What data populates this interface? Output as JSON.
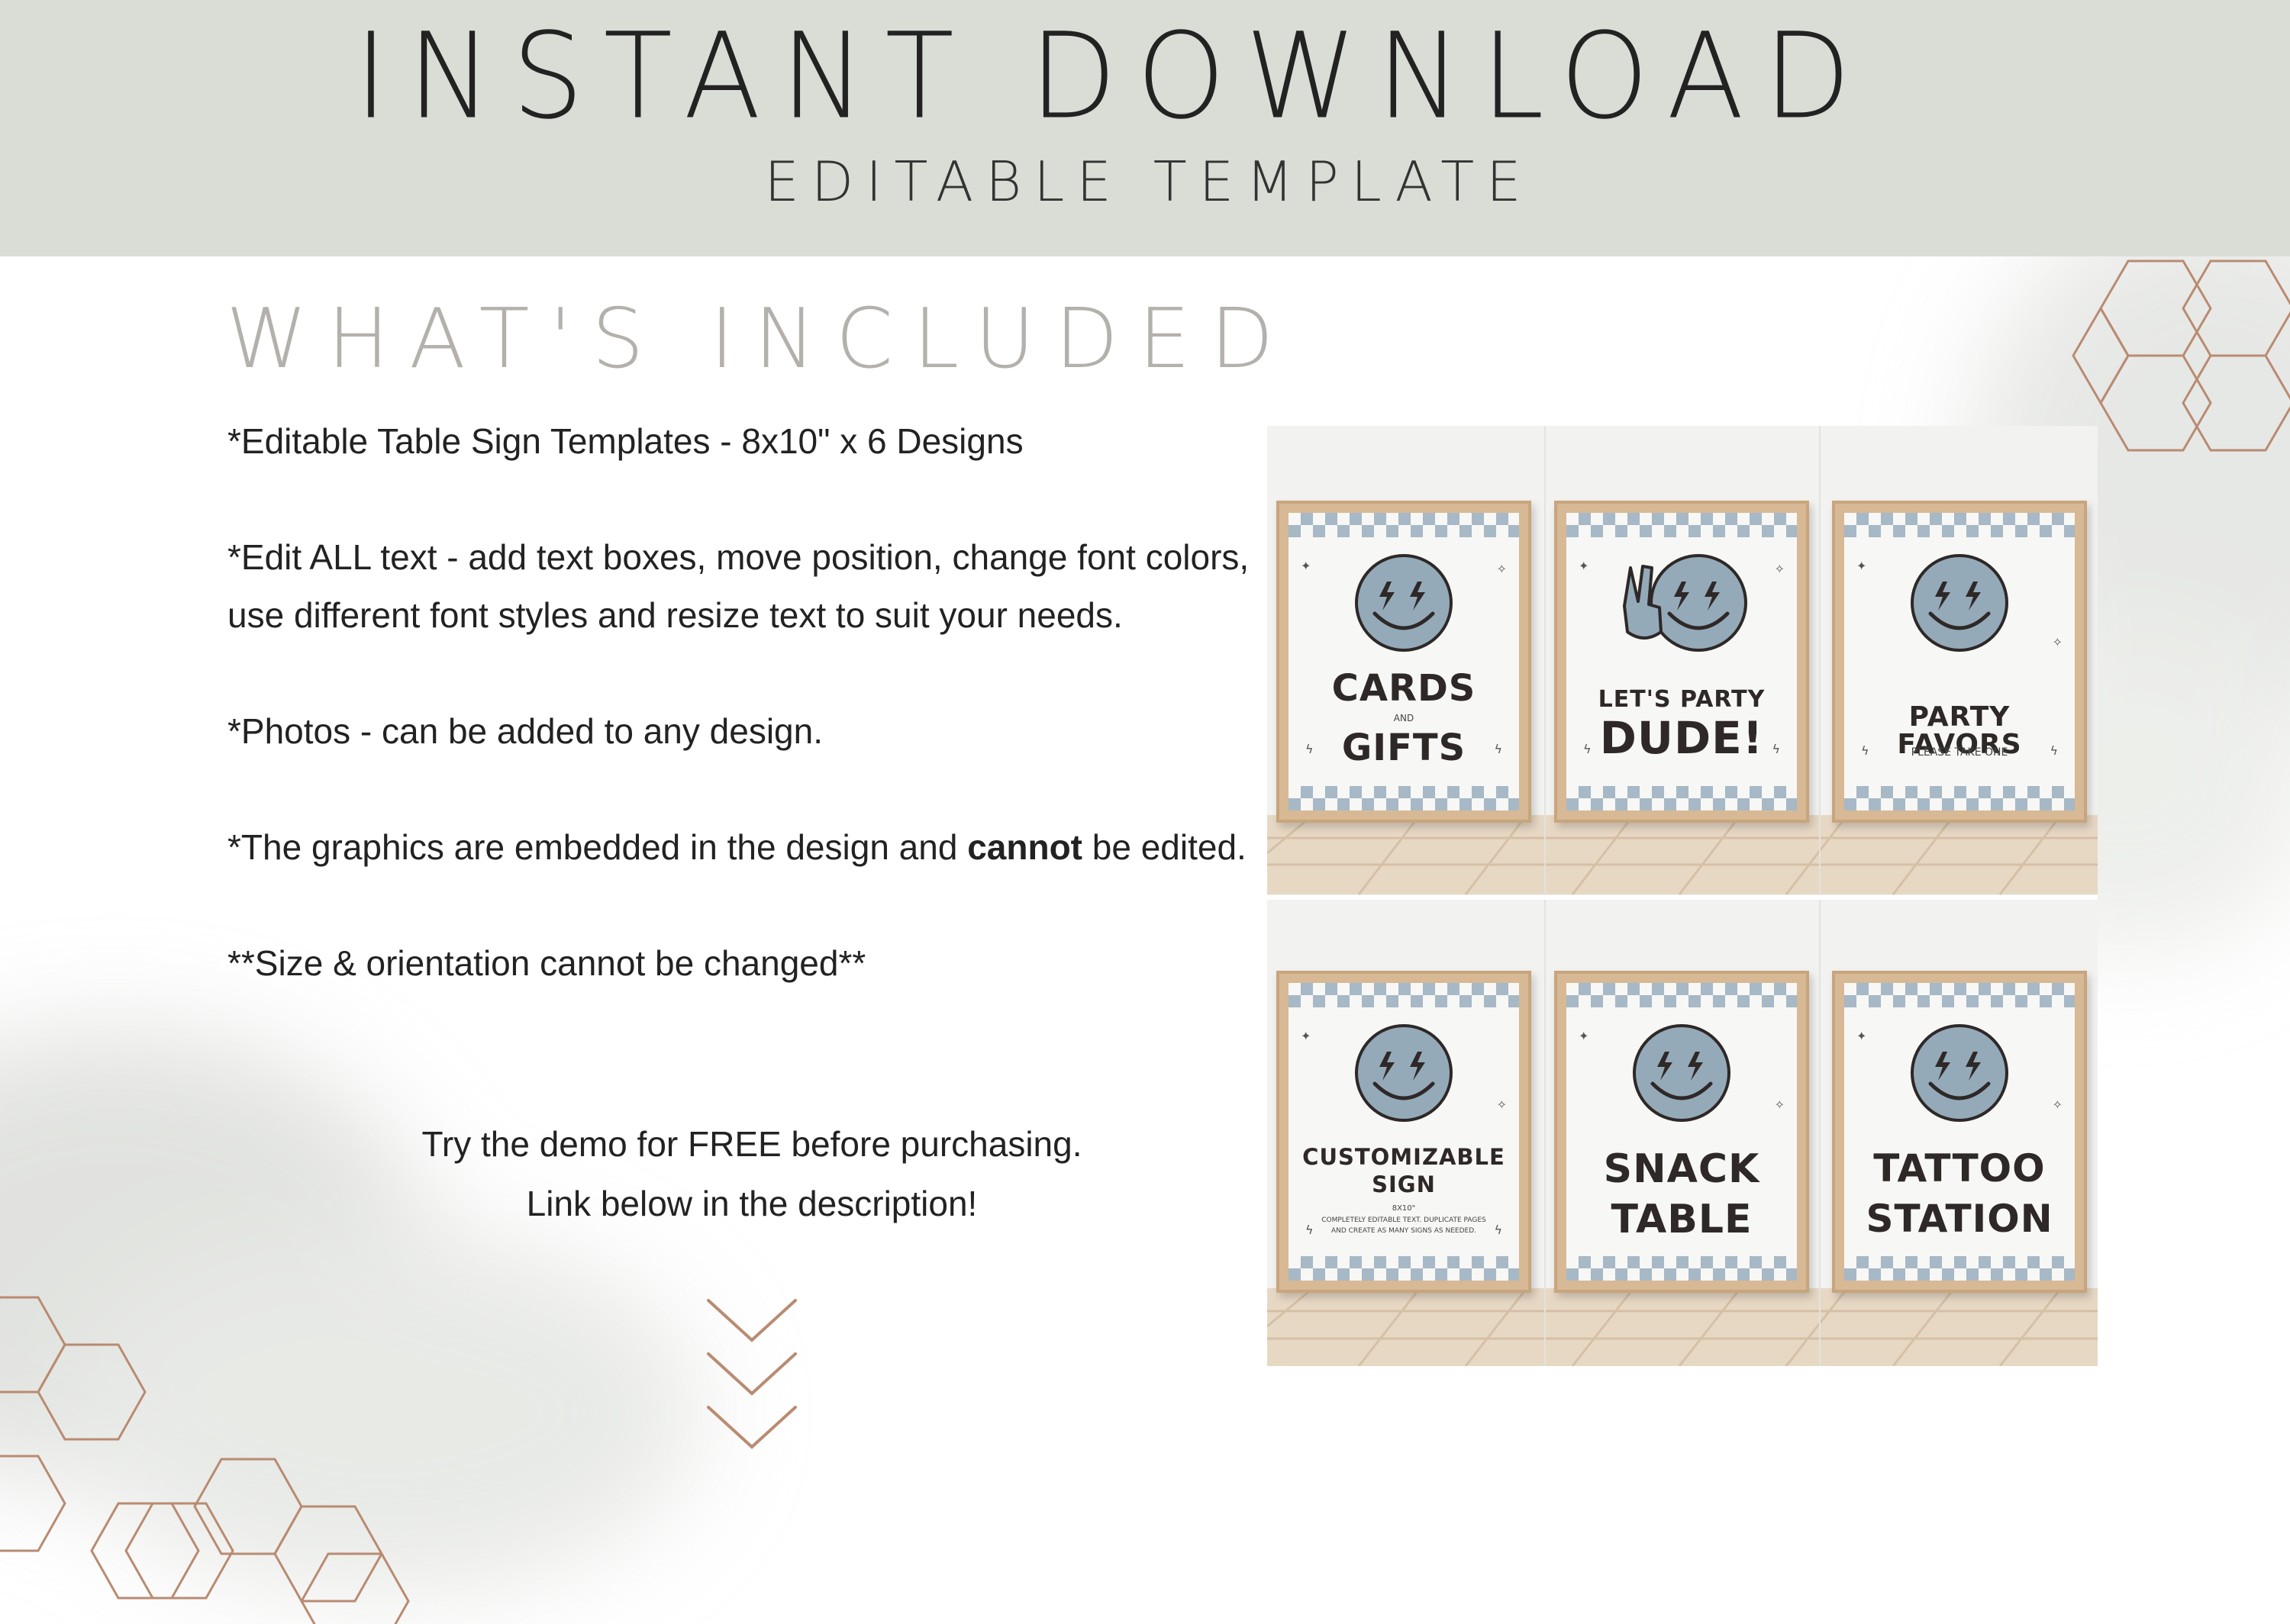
{
  "header": {
    "title": "INSTANT DOWNLOAD",
    "subtitle": "EDITABLE TEMPLATE"
  },
  "section": {
    "title": "WHAT'S INCLUDED"
  },
  "features": [
    "*Editable Table Sign Templates - 8x10\" x 6 Designs",
    "*Edit ALL text - add text boxes, move position, change font colors, use different font styles and resize text to suit your needs.",
    "*Photos - can be added to any design.",
    {
      "before": "*The graphics are embedded in the design and ",
      "bold": "cannot",
      "after": " be edited."
    },
    "**Size & orientation cannot be changed**"
  ],
  "demo": {
    "line1": "Try the demo for FREE before purchasing.",
    "line2": "Link below in the description!"
  },
  "signs": [
    {
      "line1": "CARDS",
      "small": "AND",
      "line2": "GIFTS"
    },
    {
      "line1": "LET'S PARTY",
      "line2": "DUDE!"
    },
    {
      "line1": "PARTY FAVORS",
      "small": "PLEASE TAKE ONE"
    },
    {
      "line1": "CUSTOMIZABLE",
      "line2": "SIGN",
      "small": "8X10\"",
      "note1": "COMPLETELY EDITABLE TEXT. DUPLICATE PAGES",
      "note2": "AND CREATE AS MANY SIGNS AS NEEDED."
    },
    {
      "line1": "SNACK",
      "line2": "TABLE"
    },
    {
      "line1": "TATTOO",
      "line2": "STATION"
    }
  ],
  "colors": {
    "header_band": "#d9ddd6",
    "section_title": "#b4b0ab",
    "accent_copper": "#b98b72",
    "smiley_blue": "#94aab9",
    "sign_text": "#2e2827",
    "frame_wood": "#d7b995"
  },
  "icons": [
    "hexagon-outline",
    "chevron-down",
    "smiley-face",
    "peace-hand",
    "lightning-bolt",
    "sparkle"
  ]
}
